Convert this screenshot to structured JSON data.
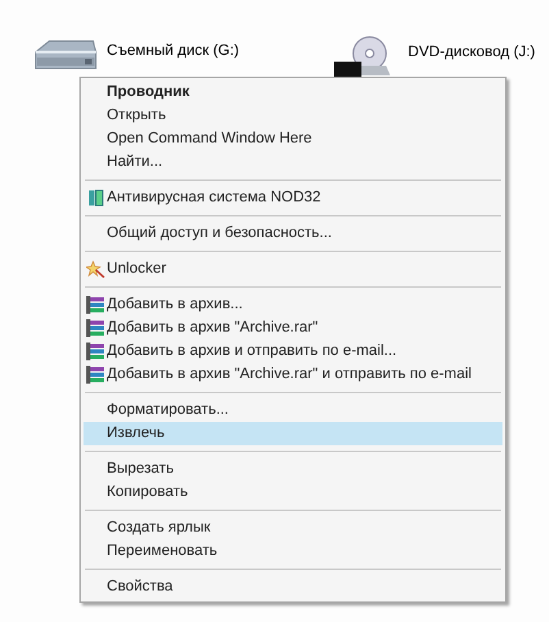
{
  "drives": [
    {
      "kind": "removable",
      "label": "Съемный диск (G:)"
    },
    {
      "kind": "dvd",
      "label": "DVD-дисковод (J:)"
    }
  ],
  "context_menu": {
    "groups": [
      [
        {
          "label": "Проводник",
          "default": true,
          "selected": false,
          "kind": "plain"
        },
        {
          "label": "Открыть",
          "default": false,
          "selected": false,
          "kind": "plain"
        },
        {
          "label": "Open Command Window Here",
          "default": false,
          "selected": false,
          "kind": "plain"
        },
        {
          "label": "Найти...",
          "default": false,
          "selected": false,
          "kind": "plain"
        }
      ],
      [
        {
          "label": "Антивирусная система NOD32",
          "default": false,
          "selected": false,
          "kind": "antivirus"
        }
      ],
      [
        {
          "label": "Общий доступ и безопасность...",
          "default": false,
          "selected": false,
          "kind": "plain"
        }
      ],
      [
        {
          "label": "Unlocker",
          "default": false,
          "selected": false,
          "kind": "unlocker"
        }
      ],
      [
        {
          "label": "Добавить в архив...",
          "default": false,
          "selected": false,
          "kind": "archiver"
        },
        {
          "label": "Добавить в архив \"Archive.rar\"",
          "default": false,
          "selected": false,
          "kind": "archiver"
        },
        {
          "label": "Добавить в архив и отправить по e-mail...",
          "default": false,
          "selected": false,
          "kind": "archiver"
        },
        {
          "label": "Добавить в архив \"Archive.rar\" и отправить по e-mail",
          "default": false,
          "selected": false,
          "kind": "archiver"
        }
      ],
      [
        {
          "label": "Форматировать...",
          "default": false,
          "selected": false,
          "kind": "plain"
        },
        {
          "label": "Извлечь",
          "default": false,
          "selected": true,
          "kind": "plain"
        }
      ],
      [
        {
          "label": "Вырезать",
          "default": false,
          "selected": false,
          "kind": "plain"
        },
        {
          "label": "Копировать",
          "default": false,
          "selected": false,
          "kind": "plain"
        }
      ],
      [
        {
          "label": "Создать ярлык",
          "default": false,
          "selected": false,
          "kind": "plain"
        },
        {
          "label": "Переименовать",
          "default": false,
          "selected": false,
          "kind": "plain"
        }
      ],
      [
        {
          "label": "Свойства",
          "default": false,
          "selected": false,
          "kind": "plain"
        }
      ]
    ]
  }
}
